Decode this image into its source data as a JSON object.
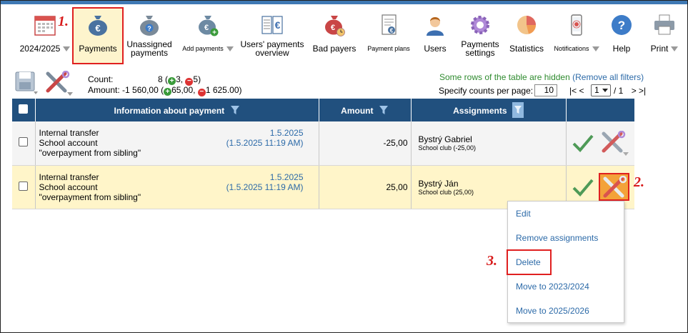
{
  "toolbar": {
    "year": "2024/2025",
    "items": [
      {
        "label": "Payments"
      },
      {
        "label": "Unassigned payments",
        "line1": "Unassigned",
        "line2": "payments"
      },
      {
        "label": "Add payments"
      },
      {
        "label": "Users' payments overview",
        "line1": "Users' payments",
        "line2": "overview"
      },
      {
        "label": "Bad payers"
      },
      {
        "label": "Payment plans"
      },
      {
        "label": "Users"
      },
      {
        "label": "Payments settings",
        "line1": "Payments",
        "line2": "settings"
      },
      {
        "label": "Statistics"
      },
      {
        "label": "Notifications"
      },
      {
        "label": "Help"
      },
      {
        "label": "Print"
      }
    ]
  },
  "steps": {
    "s1": "1.",
    "s2": "2.",
    "s3": "3."
  },
  "summary": {
    "count_label": "Count:",
    "count_value": "8 (",
    "count_plus": "3,",
    "count_minus": "5)",
    "amount_label": "Amount:",
    "amount_value": "-1 560,00 (",
    "amount_plus": "65,00,",
    "amount_minus": "1 625.00)"
  },
  "filters": {
    "hidden_note": "Some rows of the table are hidden",
    "remove_open": "(",
    "remove_link": "Remove all filters",
    "remove_close": ")",
    "per_page_label": "Specify counts per page:",
    "per_page_value": "10",
    "pager_first": "|<",
    "pager_prev": "<",
    "page_value": "1",
    "page_total": "/ 1",
    "pager_next": ">",
    "pager_last": ">|"
  },
  "table": {
    "headers": {
      "info": "Information about payment",
      "amount": "Amount",
      "assignments": "Assignments"
    },
    "rows": [
      {
        "line1": "Internal transfer",
        "line2": "School account",
        "line3": "\"overpayment from sibling\"",
        "date": "1.5.2025",
        "datetime": "(1.5.2025 11:19 AM)",
        "amount": "-25,00",
        "assignee": "Bystrý Gabriel",
        "assign_detail": "School club (-25,00)"
      },
      {
        "line1": "Internal transfer",
        "line2": "School account",
        "line3": "\"overpayment from sibling\"",
        "date": "1.5.2025",
        "datetime": "(1.5.2025 11:19 AM)",
        "amount": "25,00",
        "assignee": "Bystrý Ján",
        "assign_detail": "School club (25,00)"
      }
    ]
  },
  "context_menu": {
    "items": [
      "Edit",
      "Remove assignments",
      "Delete",
      "Move to 2023/2024",
      "Move to 2025/2026"
    ]
  },
  "colors": {
    "header_bg": "#21507e",
    "highlight_row": "#fff5c9",
    "annotation_red": "#d81b1b",
    "link": "#2c6aa8"
  }
}
